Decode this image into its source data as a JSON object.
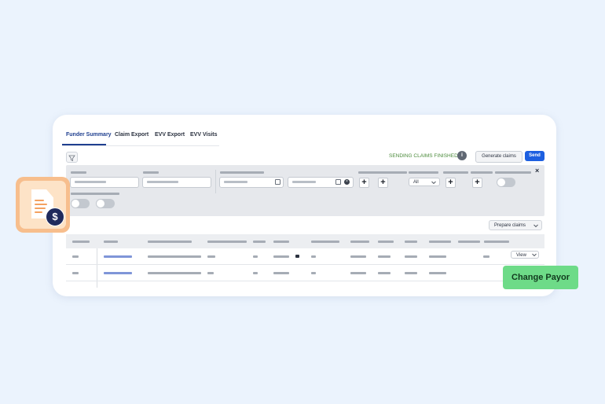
{
  "tabs": [
    {
      "label": "Funder Summary",
      "active": true
    },
    {
      "label": "Claim Export",
      "active": false
    },
    {
      "label": "EVV Export",
      "active": false
    },
    {
      "label": "EVV Visits",
      "active": false
    }
  ],
  "toolbar": {
    "status_text": "SENDING CLAIMS FINISHED",
    "generate_label": "Generate claims",
    "send_label": "Send",
    "info_glyph": "i"
  },
  "filters": {
    "status_select_value": "All",
    "close_glyph": "×"
  },
  "actions": {
    "prepare_label": "Prepare claims"
  },
  "table": {
    "row_action_label": "View"
  },
  "badge": {
    "icon": "invoice-dollar-icon",
    "dollar_glyph": "$"
  },
  "callout": {
    "label": "Change Payor"
  },
  "colors": {
    "background": "#ebf3fd",
    "accent": "#1d5fe0",
    "status": "#4a8a3a",
    "callout": "#6edb88",
    "badge": "#f7be8d"
  }
}
